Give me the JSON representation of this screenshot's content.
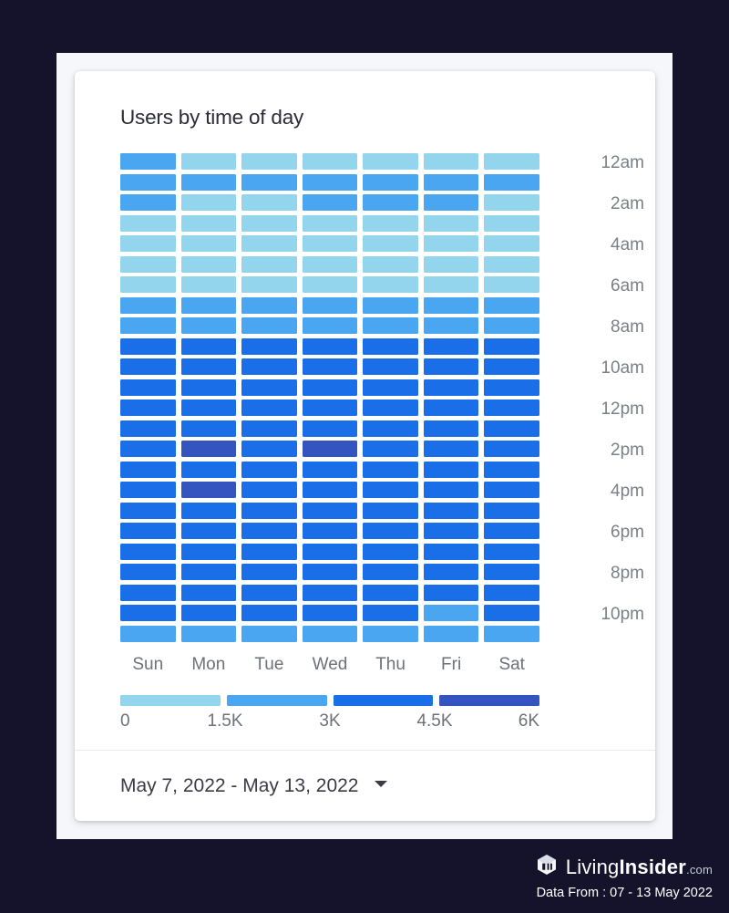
{
  "page": {
    "background_color": "#15132b",
    "frame_color": "#f5f7fa",
    "card_color": "#ffffff"
  },
  "card": {
    "title": "Users by time of day"
  },
  "footer": {
    "date_range": "May 7, 2022 - May 13, 2022",
    "chevron_icon": "chevron-down-icon"
  },
  "brand": {
    "logo_icon": "living-insider-cube-logo-icon",
    "name_light": "Living",
    "name_bold": "Insider",
    "tld": ".com",
    "subtext": "Data From : 07 - 13 May 2022"
  },
  "legend": {
    "colors": [
      "#92d5ec",
      "#4ba6f2",
      "#1a6ee8",
      "#3455c0"
    ],
    "ticks": [
      "0",
      "1.5K",
      "3K",
      "4.5K",
      "6K"
    ],
    "tick_values": [
      0,
      1500,
      3000,
      4500,
      6000
    ]
  },
  "chart_data": {
    "type": "heatmap",
    "title": "Users by time of day",
    "xlabel": "",
    "ylabel": "",
    "grid": false,
    "legend_position": "bottom",
    "value_label": "Users",
    "colorscale": [
      {
        "max": 1500,
        "color": "#92d5ec"
      },
      {
        "max": 3000,
        "color": "#4ba6f2"
      },
      {
        "max": 4500,
        "color": "#1a6ee8"
      },
      {
        "max": 6000,
        "color": "#3455c0"
      }
    ],
    "zlim": [
      0,
      6000
    ],
    "x": [
      "Sun",
      "Mon",
      "Tue",
      "Wed",
      "Thu",
      "Fri",
      "Sat"
    ],
    "x_labels": [
      "Sun",
      "Mon",
      "Tue",
      "Wed",
      "Thu",
      "Fri",
      "Sat"
    ],
    "y": [
      "12am",
      "1am",
      "2am",
      "3am",
      "4am",
      "5am",
      "6am",
      "7am",
      "8am",
      "9am",
      "10am",
      "11am",
      "12pm",
      "1pm",
      "2pm",
      "3pm",
      "4pm",
      "5pm",
      "6pm",
      "7pm",
      "8pm",
      "9pm",
      "10pm",
      "11pm"
    ],
    "y_tick_labels": [
      "12am",
      "",
      "2am",
      "",
      "4am",
      "",
      "6am",
      "",
      "8am",
      "",
      "10am",
      "",
      "12pm",
      "",
      "2pm",
      "",
      "4pm",
      "",
      "6pm",
      "",
      "8pm",
      "",
      "10pm",
      ""
    ],
    "bins": [
      [
        1,
        0,
        0,
        0,
        0,
        0,
        0
      ],
      [
        1,
        1,
        1,
        1,
        1,
        1,
        1
      ],
      [
        1,
        0,
        0,
        1,
        1,
        1,
        0
      ],
      [
        0,
        0,
        0,
        0,
        0,
        0,
        0
      ],
      [
        0,
        0,
        0,
        0,
        0,
        0,
        0
      ],
      [
        0,
        0,
        0,
        0,
        0,
        0,
        0
      ],
      [
        0,
        0,
        0,
        0,
        0,
        0,
        0
      ],
      [
        1,
        1,
        1,
        1,
        1,
        1,
        1
      ],
      [
        1,
        1,
        1,
        1,
        1,
        1,
        1
      ],
      [
        2,
        2,
        2,
        2,
        2,
        2,
        2
      ],
      [
        2,
        2,
        2,
        2,
        2,
        2,
        2
      ],
      [
        2,
        2,
        2,
        2,
        2,
        2,
        2
      ],
      [
        2,
        2,
        2,
        2,
        2,
        2,
        2
      ],
      [
        2,
        2,
        2,
        2,
        2,
        2,
        2
      ],
      [
        2,
        3,
        2,
        3,
        2,
        2,
        2
      ],
      [
        2,
        2,
        2,
        2,
        2,
        2,
        2
      ],
      [
        2,
        3,
        2,
        2,
        2,
        2,
        2
      ],
      [
        2,
        2,
        2,
        2,
        2,
        2,
        2
      ],
      [
        2,
        2,
        2,
        2,
        2,
        2,
        2
      ],
      [
        2,
        2,
        2,
        2,
        2,
        2,
        2
      ],
      [
        2,
        2,
        2,
        2,
        2,
        2,
        2
      ],
      [
        2,
        2,
        2,
        2,
        2,
        2,
        2
      ],
      [
        2,
        2,
        2,
        2,
        2,
        1,
        2
      ],
      [
        1,
        1,
        1,
        1,
        1,
        1,
        1
      ]
    ],
    "values": [
      [
        2300,
        900,
        950,
        1000,
        950,
        1050,
        1000
      ],
      [
        2400,
        2100,
        2050,
        2200,
        2250,
        2150,
        1900
      ],
      [
        2350,
        1100,
        1150,
        2250,
        2300,
        2200,
        1200
      ],
      [
        1150,
        1100,
        1050,
        1100,
        1150,
        1100,
        1050
      ],
      [
        1100,
        1050,
        1100,
        1050,
        1100,
        1050,
        1100
      ],
      [
        1050,
        1000,
        1050,
        1000,
        1050,
        1000,
        1050
      ],
      [
        1200,
        1150,
        1200,
        1150,
        1200,
        1150,
        1200
      ],
      [
        2400,
        2350,
        2400,
        2350,
        2400,
        2350,
        2400
      ],
      [
        2600,
        2550,
        2600,
        2550,
        2600,
        2550,
        2600
      ],
      [
        3700,
        3650,
        3700,
        3650,
        3700,
        3650,
        3700
      ],
      [
        3900,
        3850,
        3900,
        3850,
        3900,
        3850,
        3900
      ],
      [
        4000,
        3950,
        4000,
        3950,
        4000,
        3950,
        4000
      ],
      [
        4050,
        4000,
        4050,
        4000,
        4050,
        4000,
        4050
      ],
      [
        4100,
        4050,
        4100,
        4050,
        4100,
        4050,
        4100
      ],
      [
        4200,
        4900,
        4150,
        4850,
        4150,
        4100,
        4150
      ],
      [
        4150,
        4050,
        4100,
        4050,
        4100,
        4050,
        4100
      ],
      [
        4200,
        4950,
        4150,
        4100,
        4150,
        4100,
        4150
      ],
      [
        4100,
        4050,
        4100,
        4050,
        4100,
        4050,
        4100
      ],
      [
        4050,
        4000,
        4050,
        4000,
        4050,
        4000,
        4050
      ],
      [
        4000,
        3950,
        4000,
        3950,
        4000,
        3950,
        4000
      ],
      [
        3900,
        3850,
        3900,
        3850,
        3900,
        3850,
        3900
      ],
      [
        3800,
        3750,
        3800,
        3750,
        3800,
        3750,
        3800
      ],
      [
        3600,
        3550,
        3600,
        3550,
        3600,
        2700,
        3600
      ],
      [
        2500,
        2450,
        2500,
        2450,
        2500,
        2450,
        2500
      ]
    ]
  }
}
